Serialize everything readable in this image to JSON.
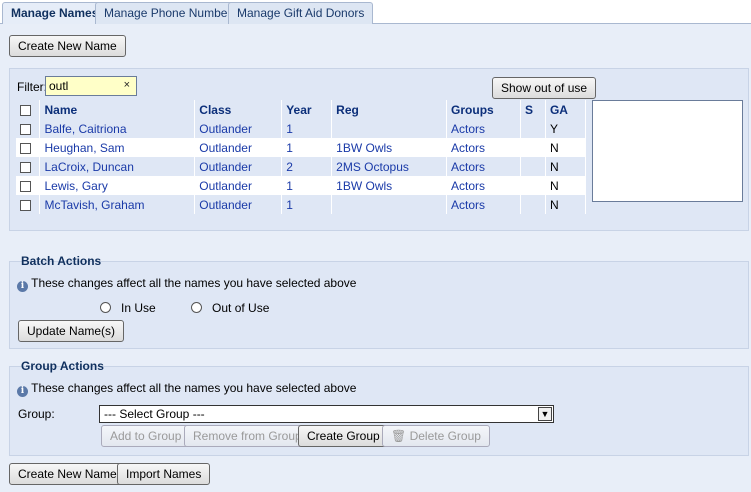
{
  "tabs": [
    {
      "label": "Manage Names"
    },
    {
      "label": "Manage Phone Numbers"
    },
    {
      "label": "Manage Gift Aid Donors"
    }
  ],
  "top": {
    "create_new_name": "Create New Name"
  },
  "filter": {
    "label": "Filter:",
    "value": "outl",
    "clear": "×",
    "show_out_of_use": "Show out of use"
  },
  "table": {
    "headers": [
      "Name",
      "Class",
      "Year",
      "Reg",
      "Groups",
      "S",
      "GA"
    ],
    "rows": [
      [
        "Balfe, Caitriona",
        "Outlander",
        "1",
        "",
        "Actors",
        "",
        "Y"
      ],
      [
        "Heughan, Sam",
        "Outlander",
        "1",
        "1BW Owls",
        "Actors",
        "",
        "N"
      ],
      [
        "LaCroix, Duncan",
        "Outlander",
        "2",
        "2MS Octopus",
        "Actors",
        "",
        "N"
      ],
      [
        "Lewis, Gary",
        "Outlander",
        "1",
        "1BW Owls",
        "Actors",
        "",
        "N"
      ],
      [
        "McTavish, Graham",
        "Outlander",
        "1",
        "",
        "Actors",
        "",
        "N"
      ]
    ]
  },
  "batch": {
    "title": "Batch Actions",
    "info": "These changes affect all the names you have selected above",
    "in_use": "In Use",
    "out_of_use": "Out of Use",
    "update": "Update Name(s)"
  },
  "group": {
    "title": "Group Actions",
    "info": "These changes affect all the names you have selected above",
    "label": "Group:",
    "select_value": "--- Select Group ---",
    "add": "Add to Group",
    "remove": "Remove from Group",
    "create": "Create Group",
    "delete": "Delete Group"
  },
  "bottom": {
    "create_new_name": "Create New Name",
    "import": "Import Names"
  }
}
